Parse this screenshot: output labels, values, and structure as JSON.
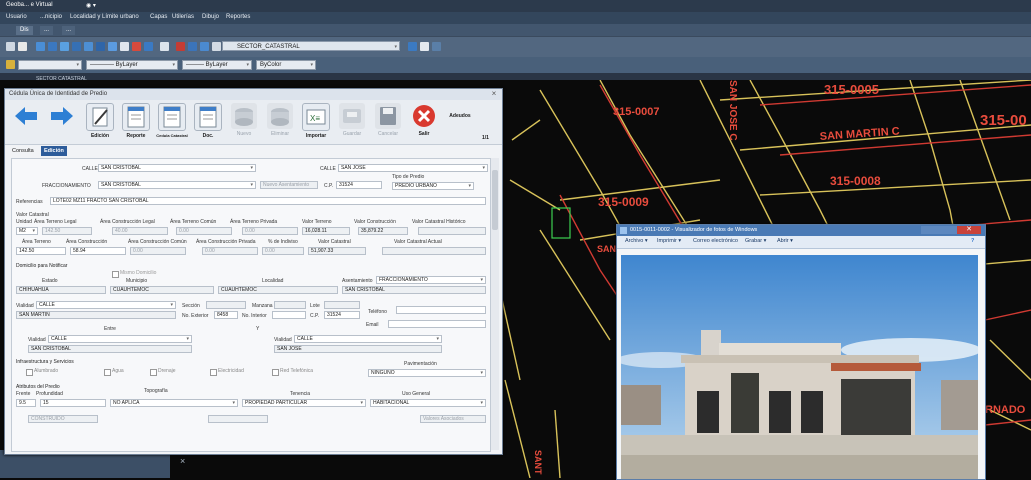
{
  "app": {
    "title": "Geoba... e Virtual",
    "menu": [
      "Usuario",
      "...nicipio",
      "Localidad y Límite urbano",
      "Capas",
      "Utilerías",
      "Dibujo",
      "Reportes"
    ],
    "ribbon_tabs": [
      "Dis",
      "...",
      "..."
    ],
    "layer_combo": "SECTOR_CATASTRAL",
    "layer_small": "SECTOR CATASTRAL",
    "linetype_combo": "———— ByLayer",
    "lineweight_combo": "——— ByLayer",
    "color_combo": "ByColor"
  },
  "cad": {
    "labels": [
      "315-0005",
      "315-0007",
      "SAN MARTIN C",
      "315-0008",
      "315-0009",
      "315-00",
      "SAN JOSE C",
      "SAN",
      "RNADO",
      "SANT"
    ]
  },
  "dialog": {
    "title": "Cédula Única de Identidad de Predio",
    "close": "×",
    "toolbar": [
      "",
      "",
      "Edición",
      "Reporte",
      "Cedula Catastral",
      "Doc.",
      "Nuevo",
      "Eliminar",
      "Importar",
      "Guardar",
      "Cancelar",
      "Salir",
      "Adeudos"
    ],
    "page_indicator": "1/1",
    "tabs": [
      "Consulta",
      "Edición"
    ],
    "calle1_label": "CALLE",
    "calle1_value": "SAN CRISTOBAL",
    "calle2_label": "CALLE",
    "calle2_value": "SAN JOSE",
    "fracc_label": "FRACCIONAMIENTO",
    "fracc_value": "SAN CRISTOBAL",
    "nuevo_asent": "Nuevo Asentamiento",
    "cp_label": "C.P.",
    "cp_value": "31524",
    "tipo_predio_label": "Tipo de Predio",
    "tipo_predio_value": "PREDIO URBANO",
    "referencias_label": "Referencias",
    "referencias_value": "LOTE02 MZ11 FRACTO SAN CRISTOBAL",
    "valor_catastral_label": "Valor Catastral",
    "row1_headers": [
      "Unidad",
      "Área Terreno Legal",
      "Área Construcción Legal",
      "Área Terreno Común",
      "Área Terreno Privada",
      "Valor Terreno",
      "Valor Construcción",
      "Valor Catastral Histórico"
    ],
    "row1_values": [
      "M2",
      "142.50",
      "40.00",
      "0.00",
      "0.00",
      "16,028.11",
      "35,879.22",
      ""
    ],
    "row2_headers": [
      "Área Terreno",
      "Área Construcción",
      "Área Construcción Común",
      "Área Construcción Privada",
      "% de Indiviso",
      "Valor Catastral",
      "Valor Catastral Actual"
    ],
    "row2_values": [
      "142.50",
      "58.94",
      "0.00",
      "0.00",
      "0.00",
      "51,907.33",
      ""
    ],
    "domicilio_label": "Domicilio para Notificar",
    "mismo_domicilio": "Mismo Domicilio",
    "estado_label": "Estado",
    "estado_value": "CHIHUAHUA",
    "municipio_label": "Municipio",
    "municipio_value": "CUAUHTEMOC",
    "localidad_label": "Localidad",
    "localidad_value": "CUAUHTEMOC",
    "asentamiento_label": "Asentamiento",
    "asentamiento_type": "FRACCIONAMIENTO",
    "asentamiento_value": "SAN CRISTOBAL",
    "vialidad_label": "Vialidad",
    "vialidad_type": "CALLE",
    "vialidad_value": "SAN MARTIN",
    "seccion_label": "Sección",
    "manzana_label": "Manzana",
    "lote_label": "Lote",
    "no_ext_label": "No. Exterior",
    "no_ext_value": "8458",
    "no_int_label": "No. Interior",
    "cp2_label": "C.P.",
    "cp2_value": "31524",
    "telefono_label": "Teléfono",
    "email_label": "Email",
    "entre_label": "Entre",
    "y_label": "Y",
    "entre1_label": "Vialidad",
    "entre1_type": "CALLE",
    "entre1_value": "SAN CRISTOBAL",
    "entre2_label": "Vialidad",
    "entre2_type": "CALLE",
    "entre2_value": "SAN JOSE",
    "infra_label": "Infraestructura y Servicios",
    "infra_items": [
      "Alumbrado",
      "Agua",
      "Drenaje",
      "Electricidad",
      "Red Telefónica"
    ],
    "pavimentacion_label": "Pavimentación",
    "pavimentacion_value": "NINGUNO",
    "atributos_label": "Atributos del Predio",
    "frente_label": "Frente",
    "frente_value": "9.5",
    "profundidad_label": "Profundidad",
    "profundidad_value": "15",
    "topografia_label": "Topografía",
    "topografia_value": "NO APLICA",
    "tenencia_label": "Tenencia",
    "tenencia_value": "PROPIEDAD PARTICULAR",
    "uso_label": "Uso General",
    "uso_value": "HABITACIONAL",
    "partial_row": [
      "CONSTRUIDO",
      "",
      "Valores Asociados"
    ]
  },
  "viewer": {
    "title": "0015-0011-0002 - Visualizador de fotos de Windows",
    "menu": [
      "Archivo ▾",
      "Imprimir ▾",
      "Correo electrónico",
      "Grabar ▾",
      "Abrir ▾"
    ]
  },
  "colors": {
    "cad_bg": "#0a0a0a",
    "parcel_line": "#d8c25a",
    "parcel_red": "#d03a32",
    "label_red": "#e84c3d",
    "accent_blue": "#2d5c9a"
  }
}
